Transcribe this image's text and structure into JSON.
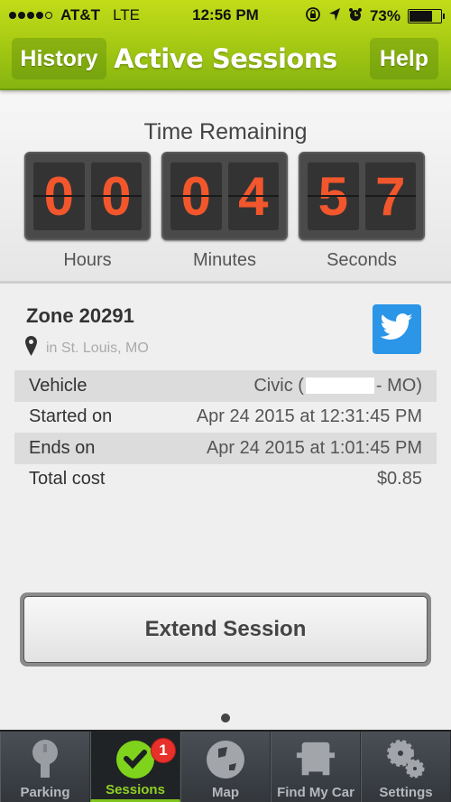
{
  "status_bar": {
    "carrier": "AT&T",
    "network": "LTE",
    "signal_bars": 4,
    "signal_max": 5,
    "time": "12:56 PM",
    "icons": [
      "rotation-lock-icon",
      "location-arrow-icon",
      "alarm-icon"
    ],
    "battery_percent": "73%",
    "battery_level": 0.73
  },
  "header": {
    "left_button": "History",
    "title": "Active Sessions",
    "right_button": "Help",
    "color": "#a9cc14"
  },
  "timer": {
    "title": "Time Remaining",
    "groups": [
      {
        "label": "Hours",
        "digits": [
          "0",
          "0"
        ]
      },
      {
        "label": "Minutes",
        "digits": [
          "0",
          "4"
        ]
      },
      {
        "label": "Seconds",
        "digits": [
          "5",
          "7"
        ]
      }
    ],
    "digit_color": "#f2562c"
  },
  "session": {
    "zone": "Zone 20291",
    "location": "in St. Louis, MO",
    "share_icon": "twitter-icon",
    "details": [
      {
        "label": "Vehicle",
        "value_prefix": "Civic (",
        "value_redacted": true,
        "value_suffix": "- MO)"
      },
      {
        "label": "Started on",
        "value": "Apr 24 2015 at 12:31:45 PM"
      },
      {
        "label": "Ends on",
        "value": "Apr 24 2015 at 1:01:45 PM"
      },
      {
        "label": "Total cost",
        "value": "$0.85"
      }
    ]
  },
  "actions": {
    "extend_label": "Extend Session"
  },
  "pager": {
    "pages": 1,
    "current": 1
  },
  "tabbar": {
    "items": [
      {
        "label": "Parking",
        "icon": "parking-meter-icon",
        "active": false
      },
      {
        "label": "Sessions",
        "icon": "sessions-check-icon",
        "active": true,
        "badge": "1"
      },
      {
        "label": "Map",
        "icon": "globe-icon",
        "active": false
      },
      {
        "label": "Find My Car",
        "icon": "car-icon",
        "active": false
      },
      {
        "label": "Settings",
        "icon": "gears-icon",
        "active": false
      }
    ],
    "active_color": "#8fd024",
    "badge_color": "#e8302a"
  }
}
